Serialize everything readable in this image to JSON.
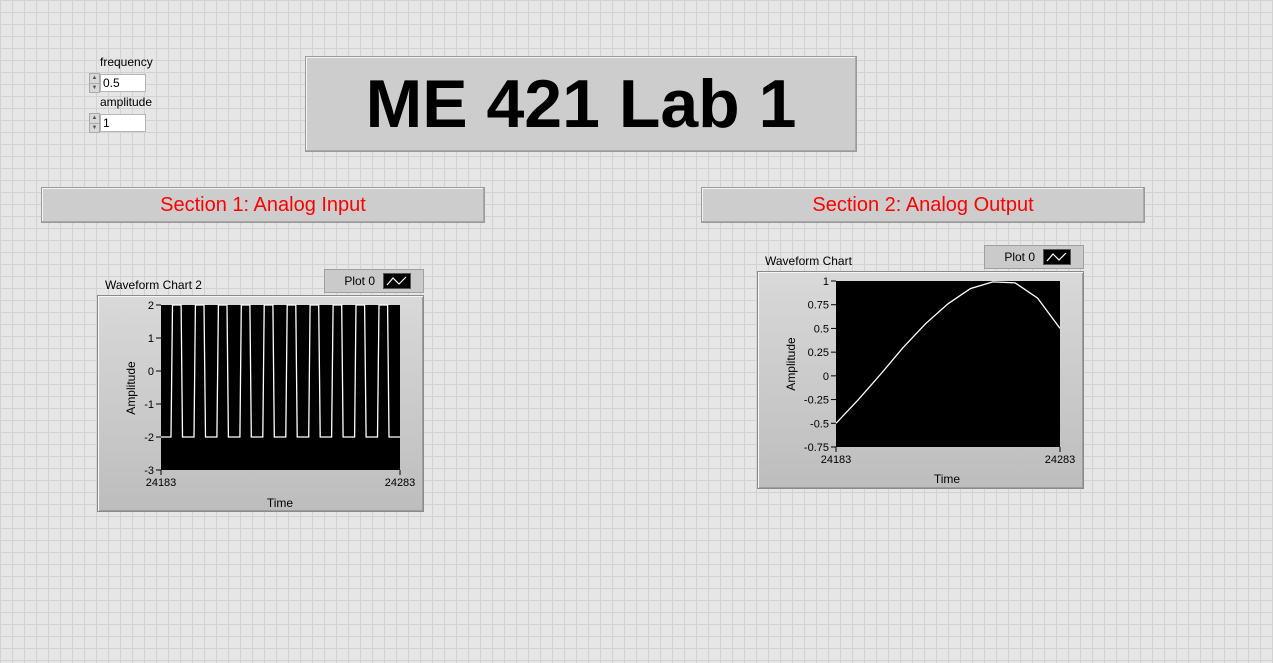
{
  "controls": {
    "frequency": {
      "label": "frequency",
      "value": "0.5"
    },
    "amplitude": {
      "label": "amplitude",
      "value": "1"
    }
  },
  "title": "ME 421 Lab 1",
  "section1": {
    "label": "Section 1: Analog Input",
    "color": "#ff0000"
  },
  "section2": {
    "label": "Section 2: Analog Output",
    "color": "#ff0000"
  },
  "chart1": {
    "label": "Waveform Chart 2",
    "legend": "Plot 0",
    "xlabel": "Time",
    "ylabel": "Amplitude",
    "x_ticks": [
      "24183",
      "24283"
    ],
    "y_ticks": [
      "2",
      "1",
      "0",
      "-1",
      "-2",
      "-3"
    ]
  },
  "chart2": {
    "label": "Waveform Chart",
    "legend": "Plot 0",
    "xlabel": "Time",
    "ylabel": "Amplitude",
    "x_ticks": [
      "24183",
      "24283"
    ],
    "y_ticks": [
      "1",
      "0.75",
      "0.5",
      "0.25",
      "0",
      "-0.25",
      "-0.5",
      "-0.75"
    ]
  },
  "chart_data": [
    {
      "type": "line",
      "title": "Waveform Chart 2",
      "xlabel": "Time",
      "ylabel": "Amplitude",
      "xlim": [
        24183,
        24283
      ],
      "ylim": [
        -3,
        2
      ],
      "grid": false,
      "legend": "top-right",
      "series": [
        {
          "name": "Plot 0",
          "color": "#ffffff",
          "waveform": "square",
          "high": 2,
          "low": -2,
          "period": 9.6,
          "x": [
            24183,
            24187.2,
            24187.2,
            24187.8,
            24187.8,
            24191.4,
            24191.4,
            24192.0
          ],
          "y": [
            -2,
            -2,
            2,
            2,
            -2,
            -2,
            2,
            2
          ]
        }
      ]
    },
    {
      "type": "line",
      "title": "Waveform Chart",
      "xlabel": "Time",
      "ylabel": "Amplitude",
      "xlim": [
        24183,
        24283
      ],
      "ylim": [
        -0.75,
        1
      ],
      "grid": false,
      "legend": "top-right",
      "series": [
        {
          "name": "Plot 0",
          "color": "#ffffff",
          "x": [
            24183,
            24193,
            24203,
            24213,
            24223,
            24233,
            24243,
            24253,
            24263,
            24273,
            24283
          ],
          "y": [
            -0.5,
            -0.25,
            0.02,
            0.3,
            0.55,
            0.76,
            0.92,
            0.99,
            0.98,
            0.82,
            0.5
          ]
        }
      ]
    }
  ]
}
